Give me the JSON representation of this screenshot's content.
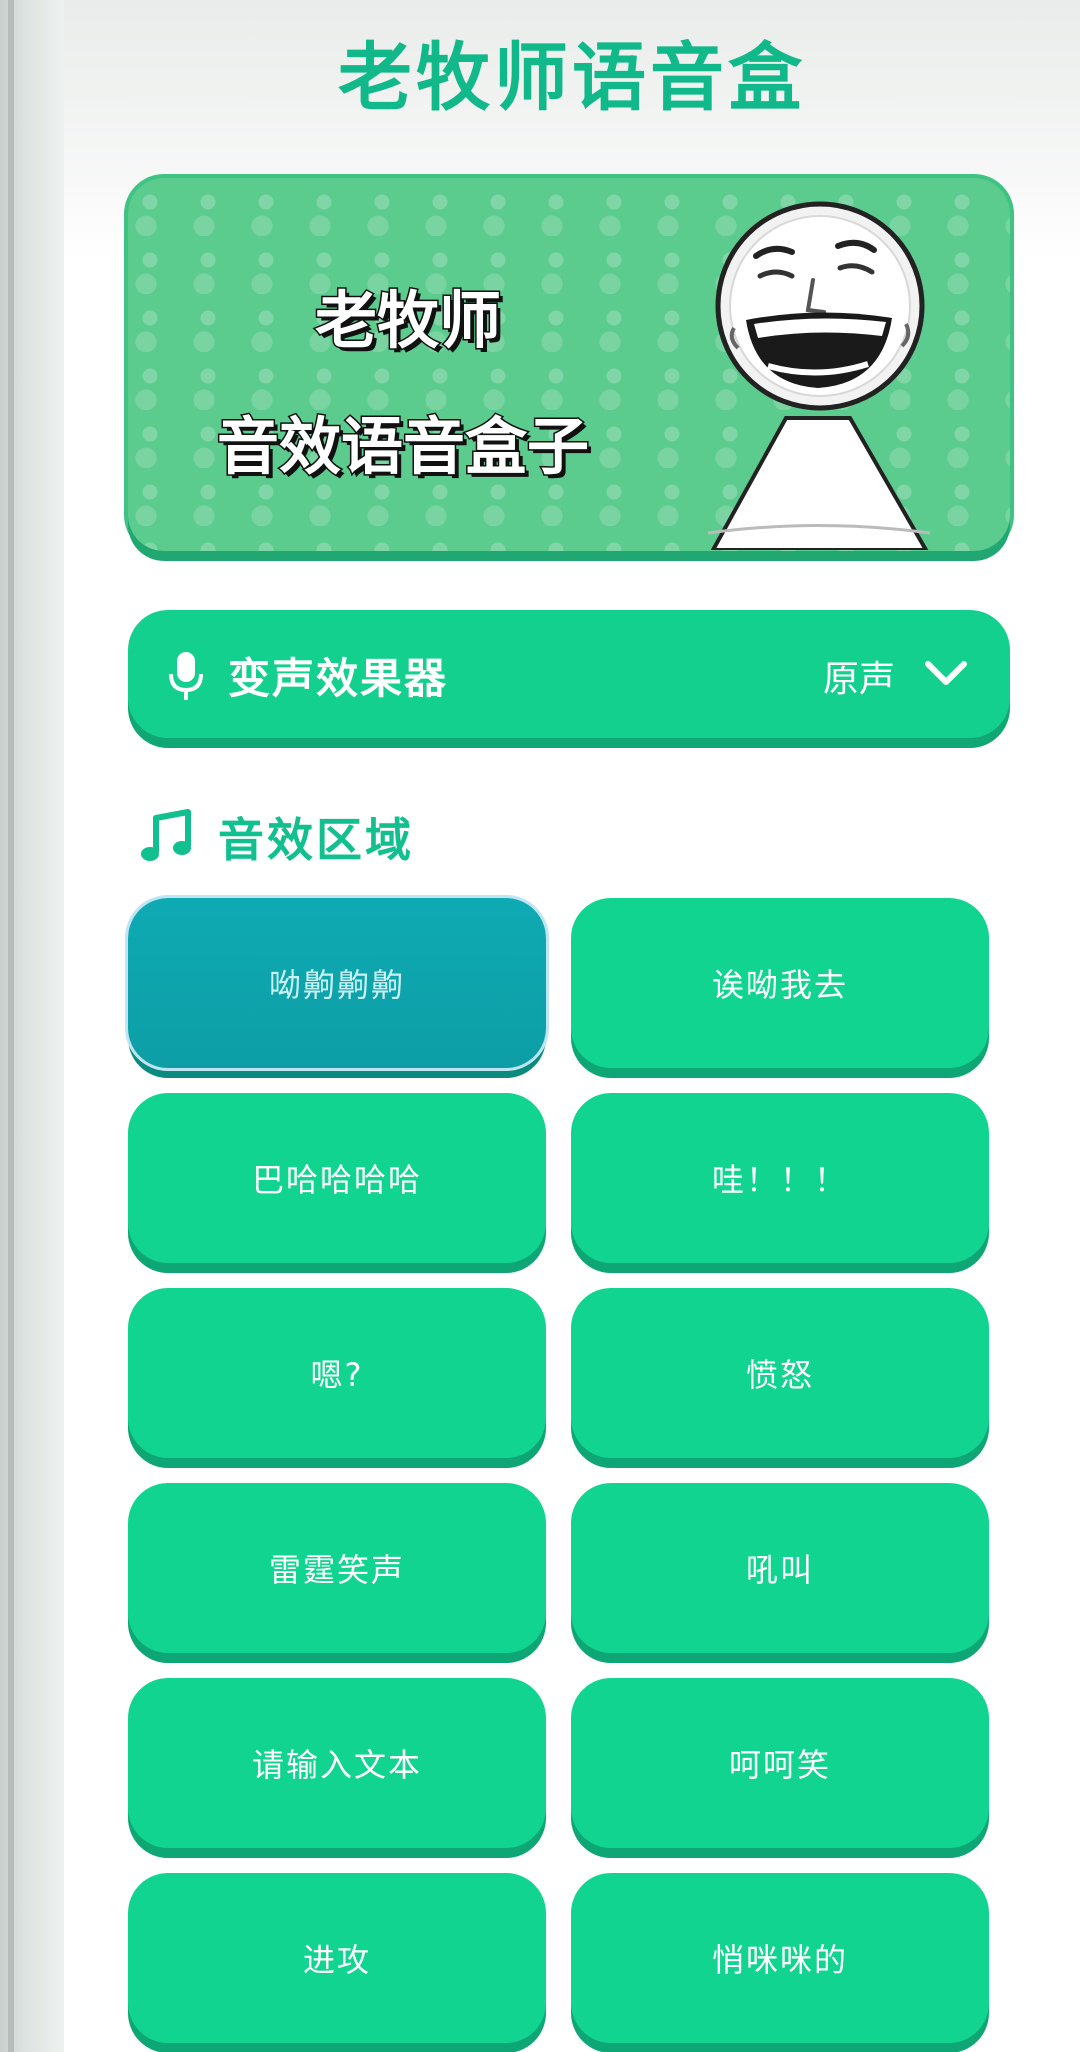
{
  "app": {
    "title": "老牧师语音盒"
  },
  "banner": {
    "line1": "老牧师",
    "line2": "音效语音盒子",
    "image": "laughing-meme-face"
  },
  "voice_changer": {
    "icon": "microphone-icon",
    "label": "变声效果器",
    "selected_value": "原声",
    "dropdown_icon": "chevron-down-icon"
  },
  "section": {
    "icon": "music-note-icon",
    "title": "音效区域"
  },
  "sounds": [
    {
      "label": "呦齁齁齁"
    },
    {
      "label": "诶呦我去"
    },
    {
      "label": "巴哈哈哈哈"
    },
    {
      "label": "哇！！！"
    },
    {
      "label": "嗯?"
    },
    {
      "label": "愤怒"
    },
    {
      "label": "雷霆笑声"
    },
    {
      "label": "吼叫"
    },
    {
      "label": "请输入文本"
    },
    {
      "label": "呵呵笑"
    },
    {
      "label": "进攻"
    },
    {
      "label": "悄咪咪的"
    }
  ],
  "colors": {
    "primary": "#10d48f",
    "title": "#11b98a",
    "selected": "#0eaab3"
  }
}
